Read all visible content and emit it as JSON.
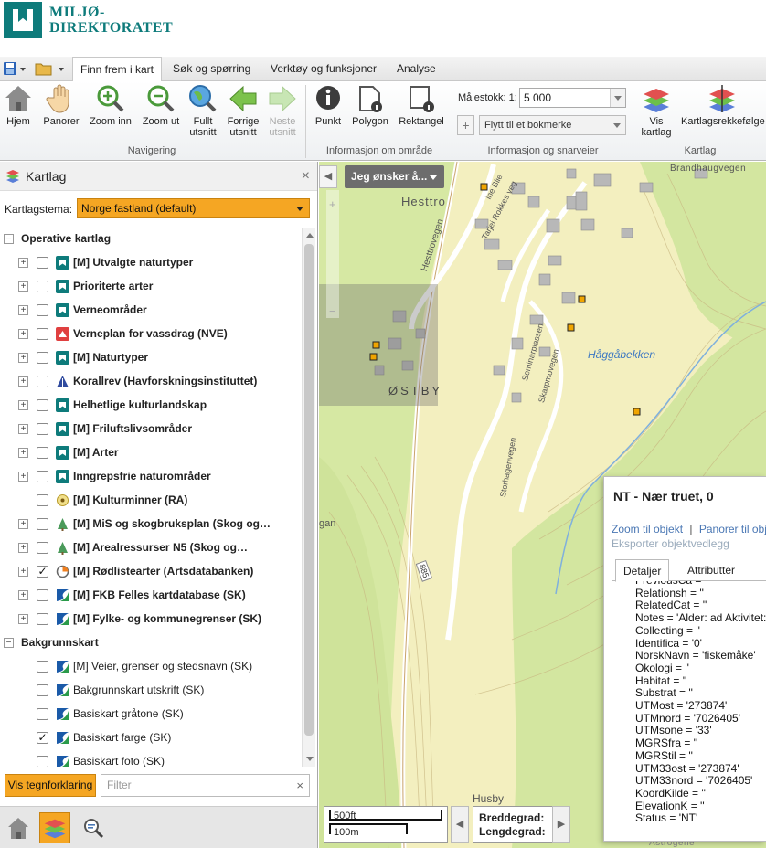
{
  "header": {
    "logo_line1": "MILJØ-",
    "logo_line2": "DIREKTORATET"
  },
  "ribbon_tabs": [
    "Finn frem i kart",
    "Søk og spørring",
    "Verktøy og funksjoner",
    "Analyse"
  ],
  "ribbon": {
    "buttons": {
      "hjem": "Hjem",
      "panorer": "Panorer",
      "zoom_inn": "Zoom inn",
      "zoom_ut": "Zoom ut",
      "fullt_utsnitt_1": "Fullt",
      "fullt_utsnitt_2": "utsnitt",
      "forrige_1": "Forrige",
      "forrige_2": "utsnitt",
      "neste_1": "Neste",
      "neste_2": "utsnitt",
      "punkt": "Punkt",
      "polygon": "Polygon",
      "rektangel": "Rektangel",
      "vis_kartlag_1": "Vis",
      "vis_kartlag_2": "kartlag",
      "rekkefolge": "Kartlagsrekkefølge"
    },
    "malestokk_label": "Målestokk: 1:",
    "malestokk_value": "5 000",
    "bokmerke": "Flytt til et bokmerke",
    "groups": {
      "navigering": "Navigering",
      "informasjon": "Informasjon om område",
      "snarveier": "Informasjon og snarveier",
      "kartlag": "Kartlag"
    }
  },
  "panel": {
    "title": "Kartlag",
    "close": "×",
    "tema_label": "Kartlagstema:",
    "tema_value": "Norge fastland (default)",
    "section_operative": "Operative kartlag",
    "section_bakgrunn": "Bakgrunnskart",
    "operative_layers": [
      {
        "label": "[M] Utvalgte naturtyper",
        "checked": false
      },
      {
        "label": "Prioriterte arter",
        "checked": false
      },
      {
        "label": "Verneområder",
        "checked": false
      },
      {
        "label": "Verneplan for vassdrag (NVE)",
        "checked": false
      },
      {
        "label": "[M] Naturtyper",
        "checked": false
      },
      {
        "label": "Korallrev (Havforskningsinstituttet)",
        "checked": false
      },
      {
        "label": "Helhetlige kulturlandskap",
        "checked": false
      },
      {
        "label": "[M] Friluftslivsområder",
        "checked": false
      },
      {
        "label": "[M] Arter",
        "checked": false
      },
      {
        "label": "Inngrepsfrie naturområder",
        "checked": false
      },
      {
        "label": "[M] Kulturminner (RA)",
        "checked": false
      },
      {
        "label": "[M] MiS og skogbruksplan (Skog og…",
        "checked": false
      },
      {
        "label": "[M] Arealressurser N5 (Skog og…",
        "checked": false
      },
      {
        "label": "[M] Rødlistearter (Artsdatabanken)",
        "checked": true
      },
      {
        "label": "[M] FKB Felles kartdatabase (SK)",
        "checked": false
      },
      {
        "label": "[M] Fylke- og kommunegrenser (SK)",
        "checked": false
      }
    ],
    "background_layers": [
      {
        "label": "[M] Veier, grenser og stedsnavn (SK)",
        "checked": false
      },
      {
        "label": "Bakgrunnskart utskrift (SK)",
        "checked": false
      },
      {
        "label": "Basiskart gråtone (SK)",
        "checked": false
      },
      {
        "label": "Basiskart farge (SK)",
        "checked": true
      },
      {
        "label": "Basiskart foto (SK)",
        "checked": false
      }
    ],
    "legend_button": "Vis tegnforklaring",
    "filter_placeholder": "Filter",
    "filter_clear": "×"
  },
  "map": {
    "jeg_onsker": "Jeg ønsker å...",
    "place_labels": {
      "hesttro": "Hesttro",
      "ostby": "ØSTBY",
      "haggabekken": "Håggåbekken",
      "husby": "Husby",
      "brandhaugvegen": "Brandhaugvegen",
      "hesttrovegen": "Hesttrovegen",
      "tanaveien": "Tarjei Rokkes veg",
      "seminar": "Seminarplassen",
      "skarpmo": "Skarpmovegen",
      "storhagen": "Storhagenvegen",
      "ine": "ine Blie",
      "gan": "gan",
      "road": "885",
      "astrogene": "Astrogene"
    },
    "scale_ft": "500ft",
    "scale_m": "100m",
    "bredde_label": "Breddegrad:",
    "lengde_label": "Lengdegrad:"
  },
  "popup": {
    "title": "NT - Nær truet, 0",
    "zoom_link": "Zoom til objekt",
    "sep": "|",
    "pan_link": "Panorer til objekt",
    "export_link": "Eksporter objektvedlegg",
    "tabs": [
      "Detaljer",
      "Attributter"
    ],
    "attributes": [
      "PreviousCa = ''",
      "Relationsh = ''",
      "RelatedCat = ''",
      "Notes = 'Alder: ad Aktivitet:",
      "Collecting = ''",
      "Identifica = '0'",
      "NorskNavn = 'fiskemåke'",
      "Okologi = ''",
      "Habitat = ''",
      "Substrat = ''",
      "UTMost = '273874'",
      "UTMnord = '7026405'",
      "UTMsone = '33'",
      "MGRSfra = ''",
      "MGRStil = ''",
      "UTM33ost = '273874'",
      "UTM33nord = '7026405'",
      "KoordKilde = ''",
      "ElevationK = ''",
      "Status = 'NT'"
    ]
  },
  "colors": {
    "accent_orange": "#f5a623",
    "brand_teal": "#0e7b7b",
    "map_green": "#cfe39a",
    "map_yellow": "#f4efc2"
  }
}
